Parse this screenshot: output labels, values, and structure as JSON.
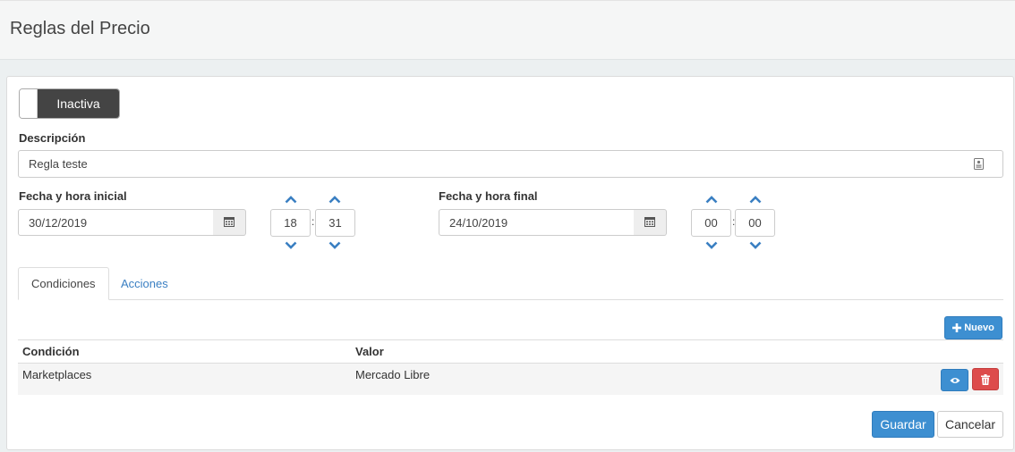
{
  "page": {
    "title": "Reglas del Precio"
  },
  "status_toggle": {
    "state_label": "Inactiva"
  },
  "form": {
    "description_label": "Descripción",
    "description_value": "Regla teste",
    "start_label": "Fecha y hora inicial",
    "start_date": "30/12/2019",
    "start_hour": "18",
    "start_minute": "31",
    "end_label": "Fecha y hora final",
    "end_date": "24/10/2019",
    "end_hour": "00",
    "end_minute": "00",
    "time_separator": ":"
  },
  "tabs": [
    {
      "label": "Condiciones",
      "active": true
    },
    {
      "label": "Acciones",
      "active": false
    }
  ],
  "conditions": {
    "new_button_label": "Nuevo",
    "columns": [
      "Condición",
      "Valor"
    ],
    "rows": [
      {
        "condition": "Marketplaces",
        "value": "Mercado Libre"
      }
    ]
  },
  "footer": {
    "save_label": "Guardar",
    "cancel_label": "Cancelar"
  },
  "icons": {
    "description_field": "contact-card-icon",
    "date_picker": "calendar-icon",
    "increment": "chevron-up-icon",
    "decrement": "chevron-down-icon",
    "new": "plus-icon",
    "view": "eye-icon",
    "delete": "trash-icon"
  },
  "colors": {
    "primary": "#3d8fd1",
    "danger": "#dd4b4b",
    "toggle_inactive": "#444444",
    "link": "#3a7fc2"
  }
}
